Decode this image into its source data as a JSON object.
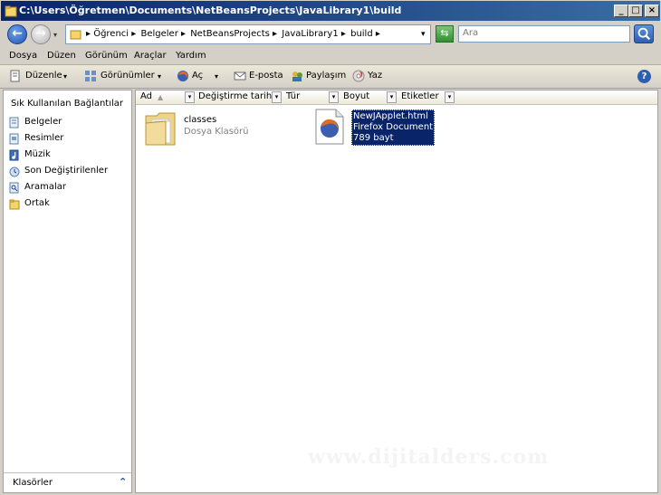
{
  "window": {
    "title": "C:\\Users\\Öğretmen\\Documents\\NetBeansProjects\\JavaLibrary1\\build",
    "min_label": "_",
    "max_label": "□",
    "close_label": "×"
  },
  "nav": {
    "back_label": "←",
    "forward_label": "→",
    "breadcrumbs": [
      "▸ Öğrenci ▸",
      "Belgeler ▸",
      "NetBeansProjects ▸",
      "JavaLibrary1 ▸",
      "build ▸"
    ],
    "dropdown_glyph": "▾",
    "refresh_label": "⇆",
    "search_placeholder": "Ara"
  },
  "menu": {
    "items": [
      "Dosya",
      "Düzen",
      "Görünüm",
      "Araçlar",
      "Yardım"
    ]
  },
  "toolbar": {
    "organize": "Düzenle",
    "views": "Görünümler",
    "open": "Aç",
    "email": "E-posta",
    "share": "Paylaşım",
    "burn": "Yaz",
    "dropdown_glyph": "▾",
    "help_label": "?"
  },
  "sidebar": {
    "title": "Sık Kullanılan Bağlantılar",
    "items": [
      {
        "label": "Belgeler",
        "icon": "documents-icon"
      },
      {
        "label": "Resimler",
        "icon": "pictures-icon"
      },
      {
        "label": "Müzik",
        "icon": "music-icon"
      },
      {
        "label": "Son Değiştirilenler",
        "icon": "recent-icon"
      },
      {
        "label": "Aramalar",
        "icon": "searches-icon"
      },
      {
        "label": "Ortak",
        "icon": "public-folder-icon"
      }
    ],
    "folders_label": "Klasörler",
    "folders_chevron": "⌃"
  },
  "columns": {
    "name": "Ad",
    "sort_glyph": "▲",
    "modified": "Değiştirme tarihi",
    "type": "Tür",
    "size": "Boyut",
    "tags": "Etiketler",
    "sep_glyph": "▾"
  },
  "files": [
    {
      "name": "classes",
      "type": "Dosya Klasörü"
    },
    {
      "name": "NewJApplet.html",
      "type": "Firefox Document",
      "size": "789 bayt"
    }
  ],
  "watermark": "www.dijitalders.com",
  "colors": {
    "title_bg": "#0a246a",
    "selection_bg": "#0a246a"
  }
}
